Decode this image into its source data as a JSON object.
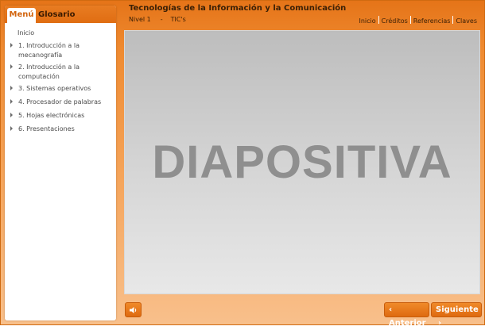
{
  "header": {
    "title": "Tecnologías de la Información y la Comunicación",
    "level": "Nivel 1",
    "separator": "-",
    "course": "TIC's",
    "links": [
      "Inicio",
      "Créditos",
      "Referencias",
      "Claves"
    ]
  },
  "sidebar": {
    "tabs": [
      "Menú",
      "Glosario"
    ],
    "active_tab": "Menú",
    "items": [
      {
        "label": "Inicio"
      },
      {
        "label": "1. Introducción a la mecanografía"
      },
      {
        "label": "2. Introducción a la computación"
      },
      {
        "label": "3. Sistemas operativos"
      },
      {
        "label": "4. Procesador de palabras"
      },
      {
        "label": "5. Hojas electrónicas"
      },
      {
        "label": "6. Presentaciones"
      }
    ]
  },
  "slide": {
    "text": "DIAPOSITIVA"
  },
  "controls": {
    "sound_icon": "speaker-icon",
    "prev_label": "Anterior",
    "next_label": "Siguiente",
    "prev_icon": "chevron-left-icon",
    "next_icon": "chevron-right-icon"
  },
  "colors": {
    "accent": "#e57418",
    "title_text": "#3b2006",
    "slide_text": "#8f8f8f"
  }
}
